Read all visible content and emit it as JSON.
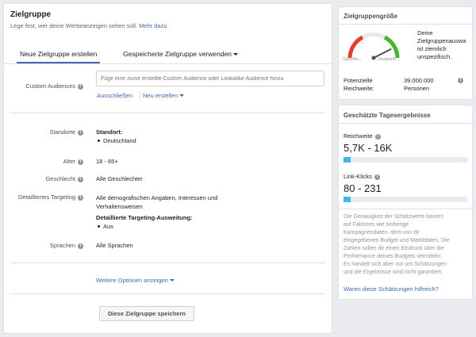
{
  "header": {
    "title": "Zielgruppe",
    "subtitle": "Lege fest, wer deine Werbeanzeigen sehen soll.",
    "more_link": "Mehr dazu"
  },
  "tabs": [
    {
      "label": "Neue Zielgruppe erstellen",
      "active": true
    },
    {
      "label": "Gespeicherte Zielgruppe verwenden",
      "active": false
    }
  ],
  "custom_audiences": {
    "label": "Custom Audiences",
    "placeholder": "Füge eine zuvor erstellte Custom Audience oder Lookalike Audience hinzu",
    "exclude_link": "Ausschließen",
    "create_link": "Neu erstellen"
  },
  "fields": {
    "locations": {
      "label": "Standorte",
      "heading": "Standort:",
      "items": [
        "Deutschland"
      ]
    },
    "age": {
      "label": "Alter",
      "value": "18 - 65+"
    },
    "gender": {
      "label": "Geschlecht",
      "value": "Alle Geschlechter"
    },
    "targeting": {
      "label": "Detailliertes Targeting",
      "value": "Alle demografischen Angaben, Interessen und Verhaltensweisen",
      "expansion_heading": "Detaillierte Targeting-Ausweitung:",
      "expansion_items": [
        "Aus"
      ]
    },
    "languages": {
      "label": "Sprachen",
      "value": "Alle Sprachen"
    }
  },
  "more_options": "Weitere Optionen anzeigen",
  "save_button": "Diese Zielgruppe speichern",
  "audience_size": {
    "title": "Zielgruppengröße",
    "gauge_left": "Spezifis...",
    "gauge_right": "Unspezifi...",
    "description": [
      "Deine",
      "Zielgruppenauswa",
      "ist ziemlich",
      "unspezifisch."
    ],
    "potential_label": [
      "Potenzielle",
      "Reichweite:"
    ],
    "potential_value": [
      "39.000.000",
      "Personen"
    ],
    "gauge_level": 0.85
  },
  "estimates": {
    "title": "Geschätzte Tagesergebnisse",
    "reach_label": "Reichweite",
    "reach_value": "5,7K - 16K",
    "reach_fill": 0.06,
    "clicks_label": "Link-Klicks",
    "clicks_value": "80 - 231",
    "clicks_fill": 0.06,
    "disclaimer": [
      "Die Genauigkeit der Schätzwerte basiert",
      "auf Faktoren wie bisherige",
      "Kampagnendaten, dem von dir",
      "eingegebenen Budget und Marktdaten. Die",
      "Zahlen sollen dir einen Eindruck über die",
      "Performance deines Budgets vermitteln.",
      "Es handelt sich aber nur um Schätzungen",
      "und die Ergebnisse sind nicht garantiert."
    ],
    "feedback_link": "Waren diese Schätzungen hilfreich?"
  },
  "colors": {
    "accent": "#4267b2",
    "bar": "#3db8e8",
    "gauge_red": "#e0402c",
    "gauge_green": "#42b72a"
  }
}
